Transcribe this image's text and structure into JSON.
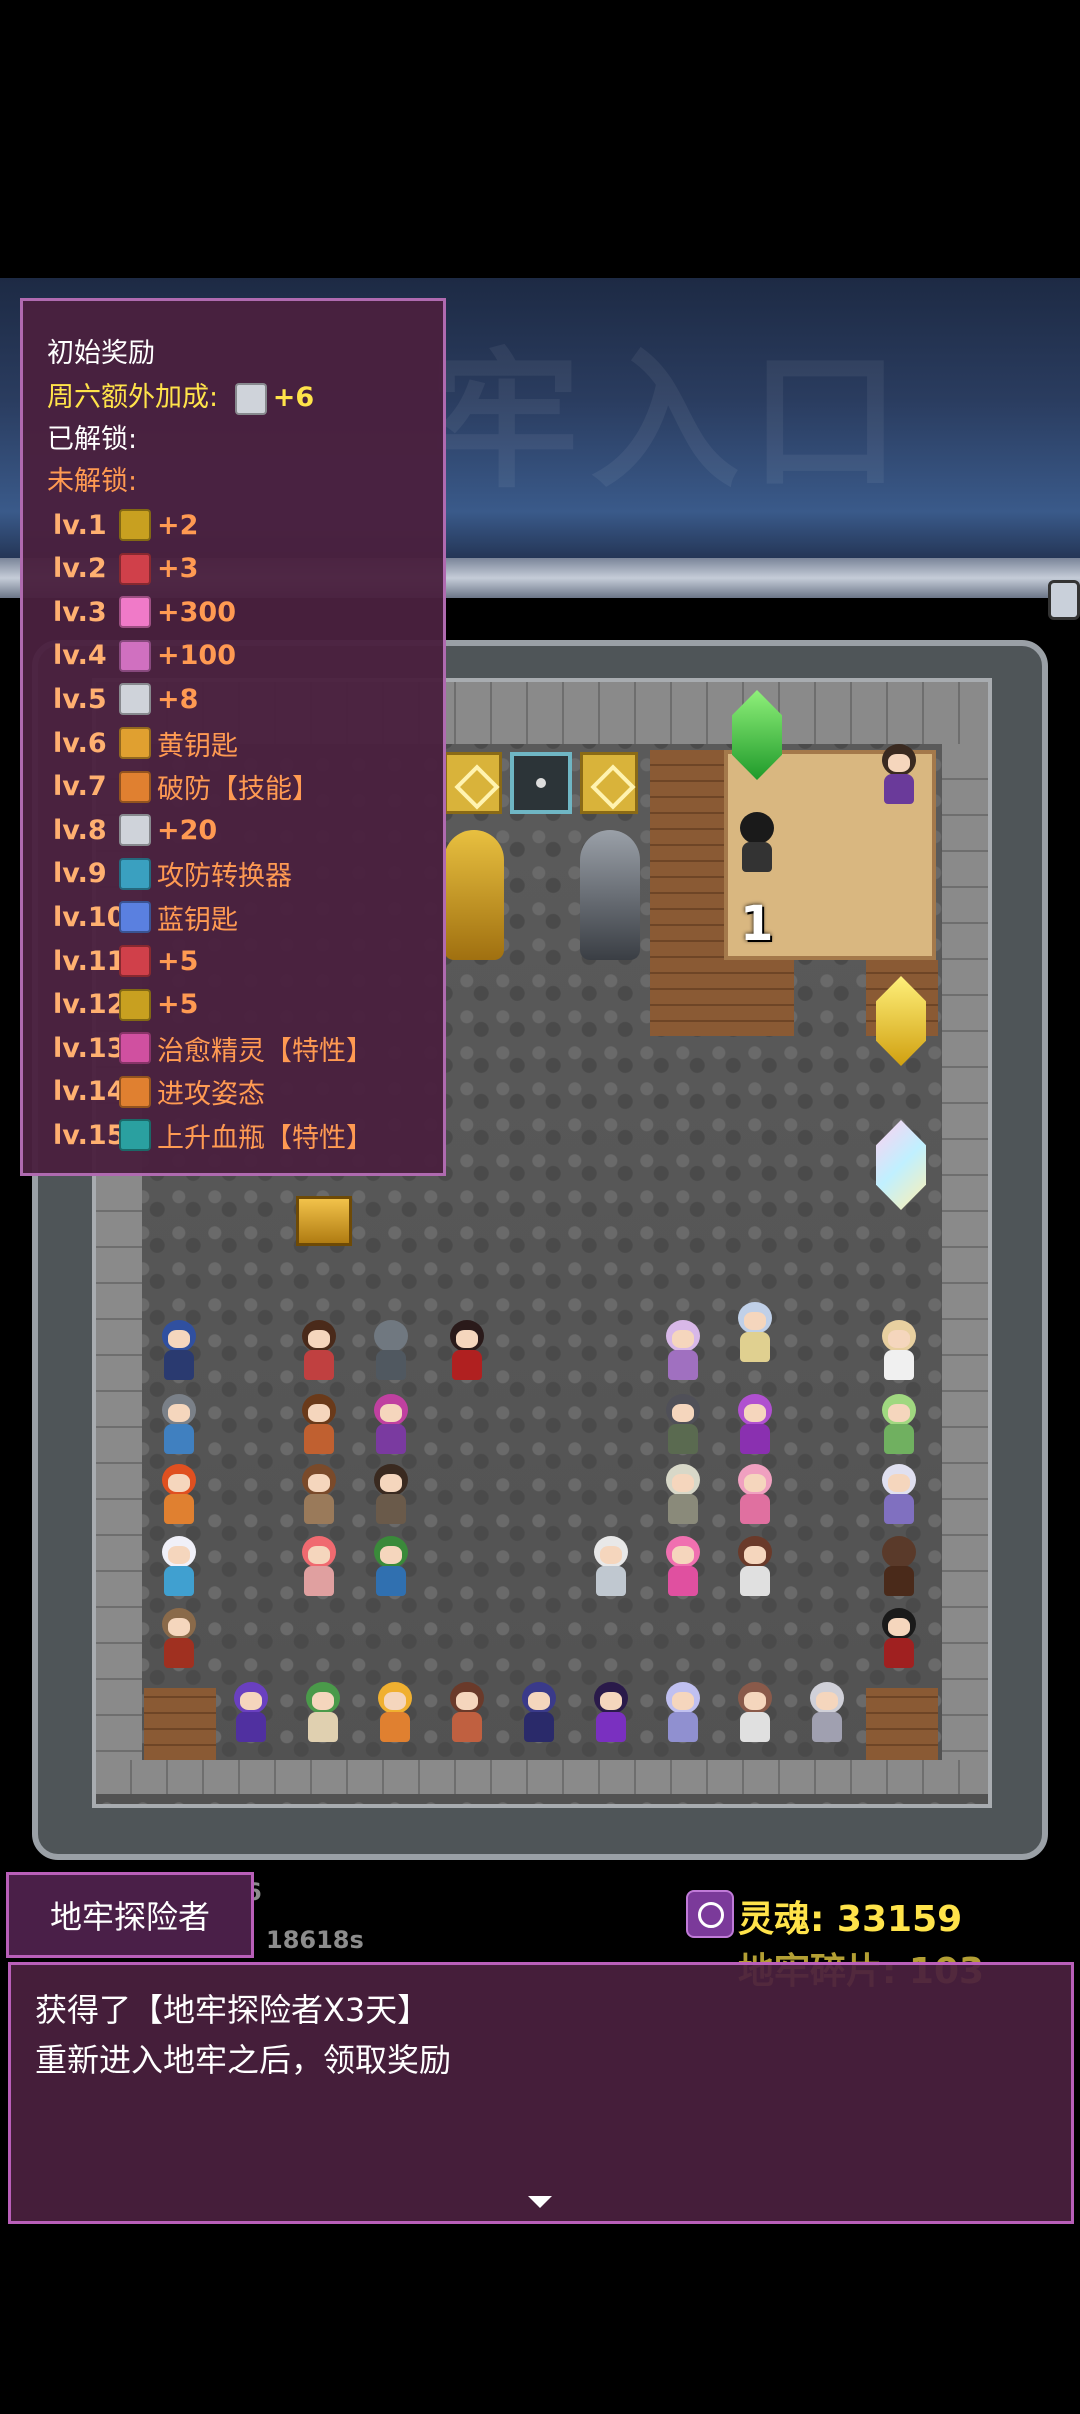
{
  "reward_panel": {
    "header": "初始奖励",
    "saturday_bonus_label": "周六额外加成:",
    "saturday_bonus_value": "+6",
    "unlocked_label": "已解锁:",
    "locked_label": "未解锁:",
    "rows": [
      {
        "lv": "lv.1",
        "icon": "shield-icon",
        "icon_color": "#c8a020",
        "text": "+2"
      },
      {
        "lv": "lv.2",
        "icon": "sword-icon",
        "icon_color": "#d0404a",
        "text": "+3"
      },
      {
        "lv": "lv.3",
        "icon": "heart-icon",
        "icon_color": "#f07ac8",
        "text": "+300"
      },
      {
        "lv": "lv.4",
        "icon": "mana-icon",
        "icon_color": "#d070c0",
        "text": "+100"
      },
      {
        "lv": "lv.5",
        "icon": "orb-icon",
        "icon_color": "#cfd3da",
        "text": "+8"
      },
      {
        "lv": "lv.6",
        "icon": "key-icon",
        "icon_color": "#e0a030",
        "text": "黄钥匙"
      },
      {
        "lv": "lv.7",
        "icon": "break-icon",
        "icon_color": "#e08030",
        "text": "破防【技能】"
      },
      {
        "lv": "lv.8",
        "icon": "orb-icon",
        "icon_color": "#cfd3da",
        "text": "+20"
      },
      {
        "lv": "lv.9",
        "icon": "computer-icon",
        "icon_color": "#3aa0c0",
        "text": "攻防转换器"
      },
      {
        "lv": "lv.10",
        "icon": "key-icon",
        "icon_color": "#5a80e0",
        "text": "蓝钥匙"
      },
      {
        "lv": "lv.11",
        "icon": "sword-icon",
        "icon_color": "#d0404a",
        "text": "+5"
      },
      {
        "lv": "lv.12",
        "icon": "shield-icon",
        "icon_color": "#c8a020",
        "text": "+5"
      },
      {
        "lv": "lv.13",
        "icon": "healing-sprite-icon",
        "icon_color": "#d050a0",
        "text": "治愈精灵【特性】"
      },
      {
        "lv": "lv.14",
        "icon": "attack-stance-icon",
        "icon_color": "#e08030",
        "text": "进攻姿态"
      },
      {
        "lv": "lv.15",
        "icon": "potion-icon",
        "icon_color": "#2aa0a0",
        "text": "上升血瓶【特性】"
      }
    ]
  },
  "map": {
    "sand_room_number": "1"
  },
  "status": {
    "tag_label": "地牢探险者",
    "faded_time": "18618s",
    "soul_label": "灵魂: 33159",
    "shard_label": "地牢碎片: 103"
  },
  "message": {
    "line1": "获得了【地牢探险者X3天】",
    "line2": "重新进入地牢之后，领取奖励"
  },
  "colors": {
    "panel_bg": "#4a203e",
    "panel_border": "#b06ab0",
    "accent_yellow": "#ffe34a",
    "locked_orange": "#ff9a52"
  }
}
